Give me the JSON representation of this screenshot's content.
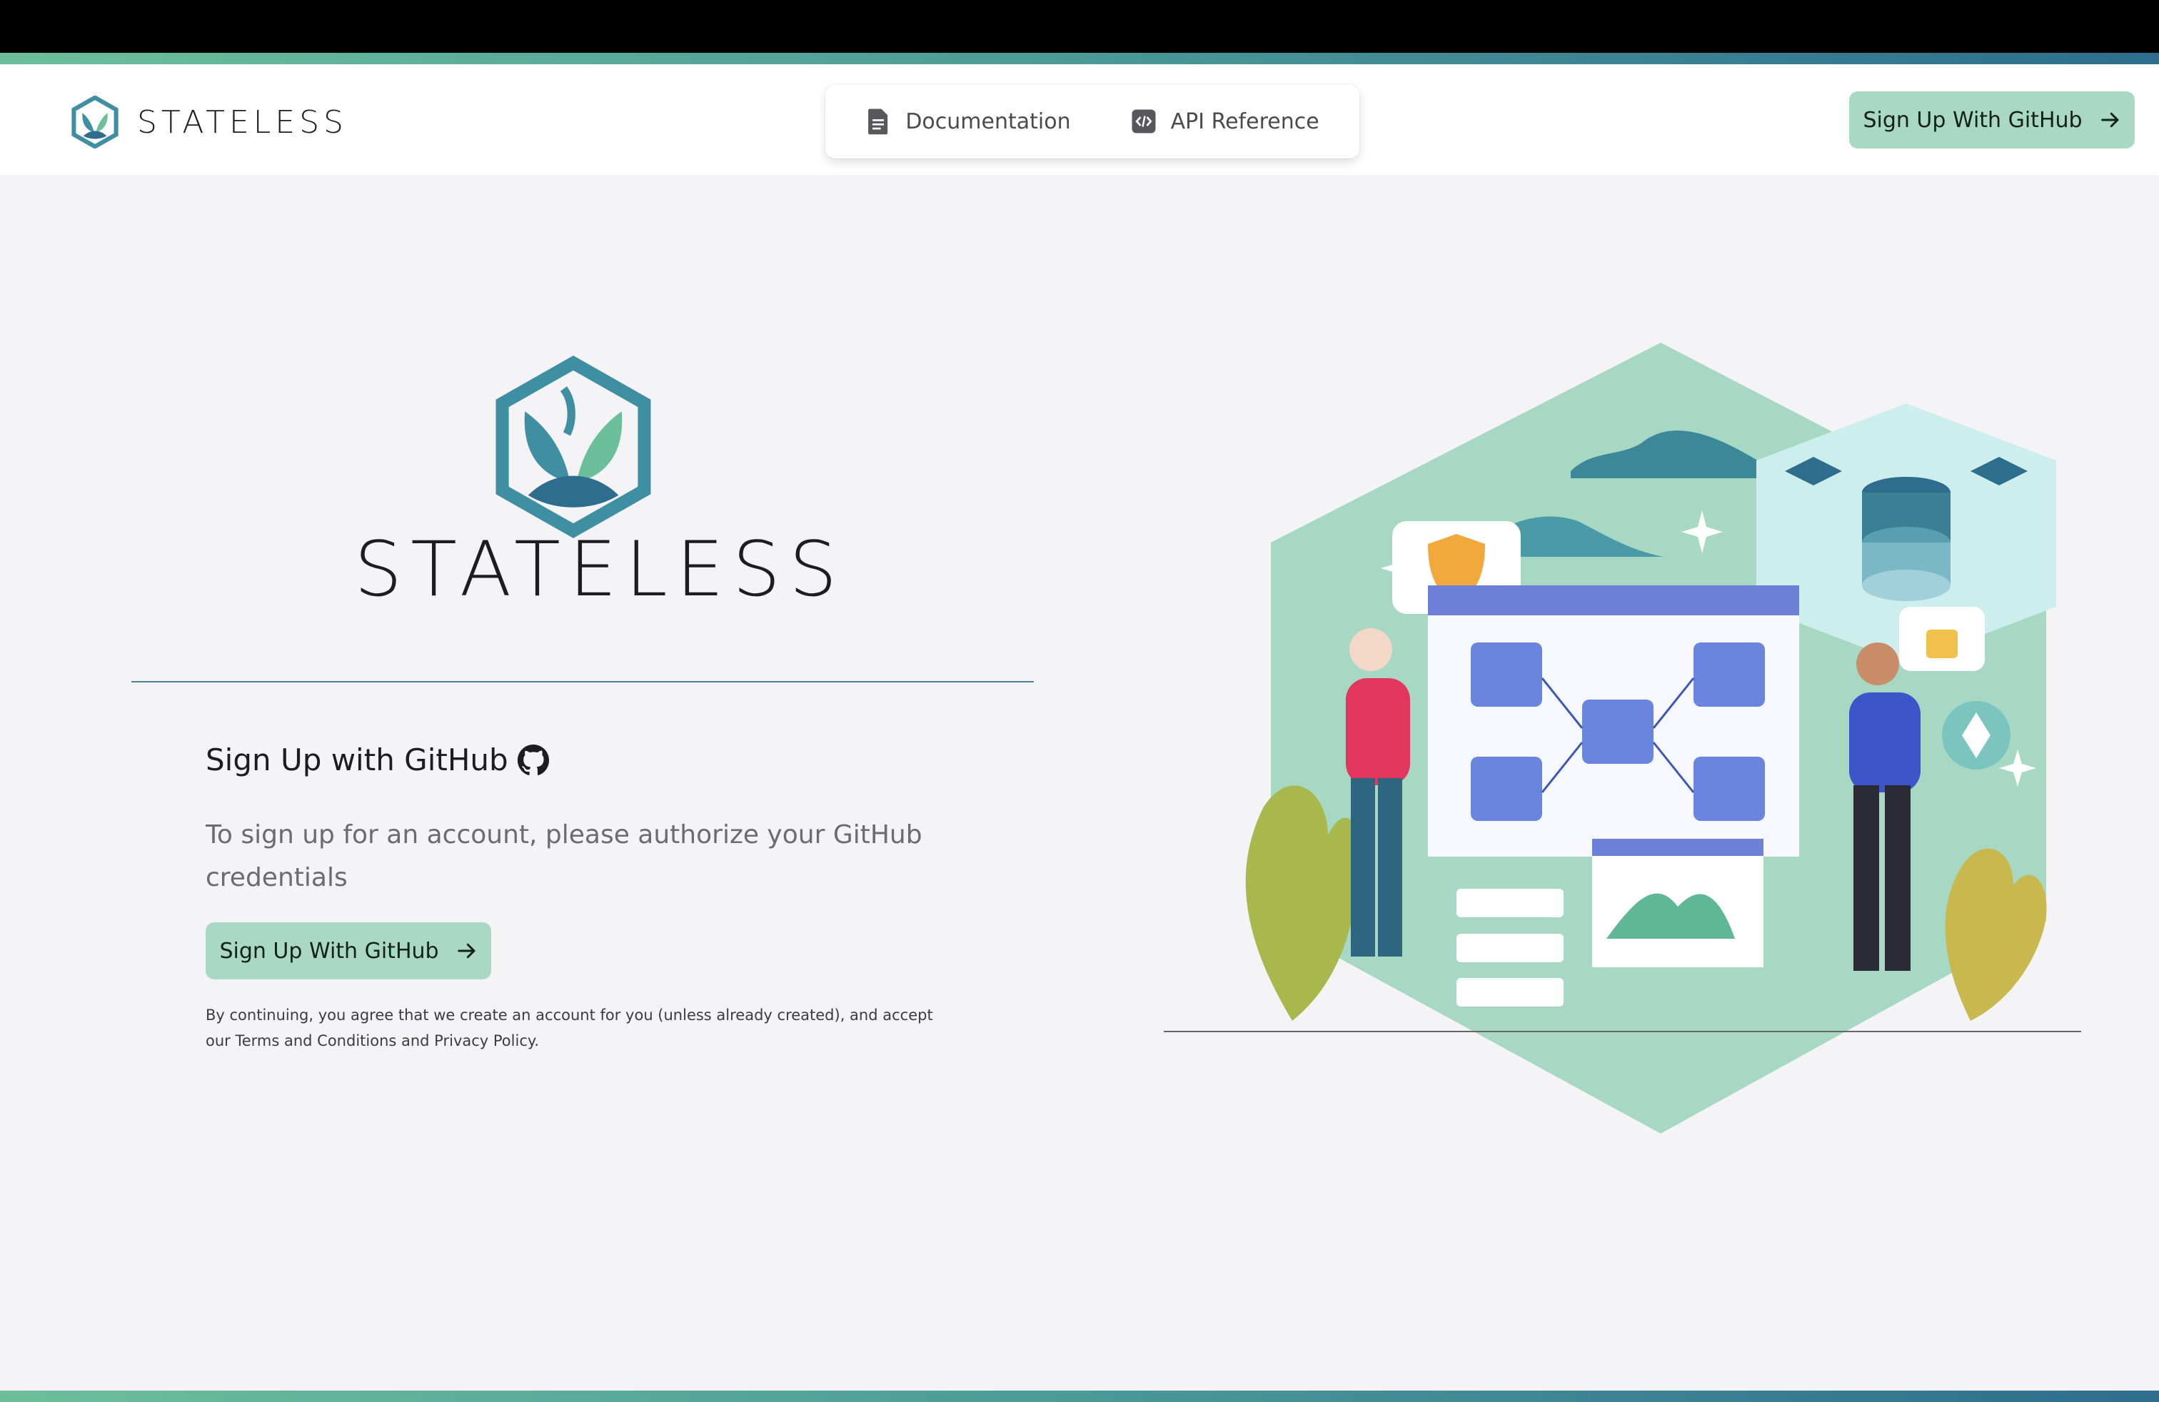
{
  "header": {
    "brand_name": "STATELESS",
    "nav": [
      {
        "label": "Documentation",
        "icon": "document-icon"
      },
      {
        "label": "API Reference",
        "icon": "code-icon"
      }
    ],
    "signup_button_label": "Sign Up With GitHub"
  },
  "hero": {
    "wordmark": "STATELESS"
  },
  "signup": {
    "title": "Sign Up with GitHub",
    "subtitle": "To sign up for an account, please authorize your GitHub credentials",
    "button_label": "Sign Up With GitHub",
    "legal": "By continuing, you agree that we create an account for you (unless already created), and accept our Terms and Conditions and Privacy Policy."
  },
  "colors": {
    "accent_green": "#a9d9c4",
    "teal_dark": "#2e6d8e",
    "teal_mid": "#4a9a98",
    "green_light": "#6cbf9b",
    "background": "#f4f4f6"
  }
}
